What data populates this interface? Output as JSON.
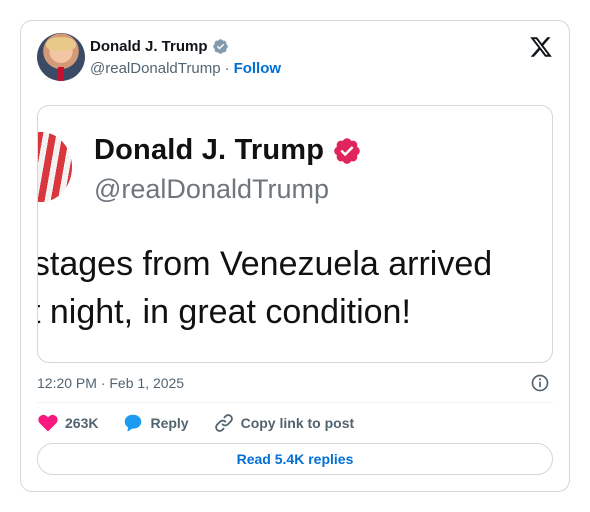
{
  "author": {
    "name": "Donald J. Trump",
    "handle": "@realDonaldTrump",
    "separator": "·",
    "follow_label": "Follow"
  },
  "media": {
    "name": "Donald J. Trump",
    "handle": "@realDonaldTrump",
    "line1": "ostages from Venezuela arrived",
    "line2": "st night, in great condition!"
  },
  "timestamp": "12:20 PM · Feb 1, 2025",
  "actions": {
    "like_count": "263K",
    "reply_label": "Reply",
    "copy_label": "Copy link to post"
  },
  "replies_button": "Read 5.4K replies",
  "icons": {
    "verified_small": "verified-badge-icon",
    "verified_large": "verified-badge-icon",
    "logo": "x-logo-icon",
    "info": "info-icon",
    "like": "heart-icon",
    "reply": "speech-bubble-icon",
    "copy": "link-icon"
  },
  "colors": {
    "link_blue": "#006fd6",
    "like_pink": "#f91880",
    "reply_blue": "#1d9bf0",
    "verified_grey": "#829aab",
    "verified_red": "#e0245e"
  }
}
